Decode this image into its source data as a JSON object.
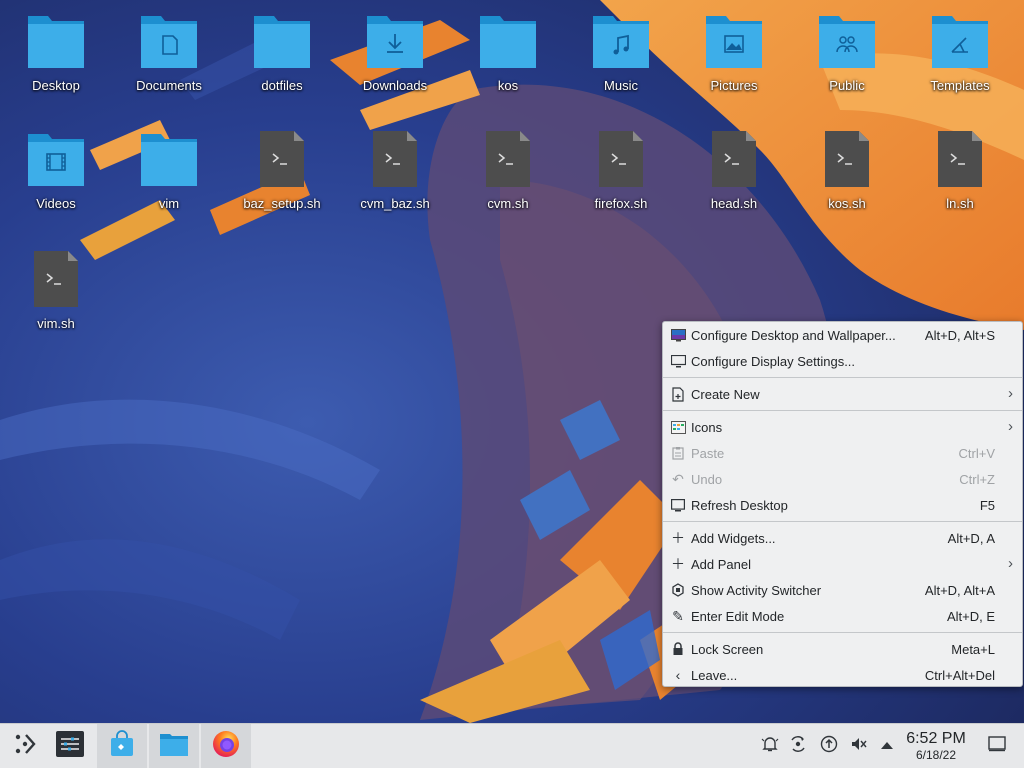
{
  "desktop": {
    "icons": [
      {
        "label": "Desktop",
        "kind": "folder",
        "glyph": "none"
      },
      {
        "label": "Documents",
        "kind": "folder",
        "glyph": "document"
      },
      {
        "label": "dotfiles",
        "kind": "folder",
        "glyph": "none"
      },
      {
        "label": "Downloads",
        "kind": "folder",
        "glyph": "download"
      },
      {
        "label": "kos",
        "kind": "folder",
        "glyph": "none"
      },
      {
        "label": "Music",
        "kind": "folder",
        "glyph": "music"
      },
      {
        "label": "Pictures",
        "kind": "folder",
        "glyph": "picture"
      },
      {
        "label": "Public",
        "kind": "folder",
        "glyph": "users"
      },
      {
        "label": "Templates",
        "kind": "folder",
        "glyph": "template"
      },
      {
        "label": "Videos",
        "kind": "folder",
        "glyph": "film"
      },
      {
        "label": "vim",
        "kind": "folder",
        "glyph": "none"
      },
      {
        "label": "baz_setup.sh",
        "kind": "script"
      },
      {
        "label": "cvm_baz.sh",
        "kind": "script"
      },
      {
        "label": "cvm.sh",
        "kind": "script"
      },
      {
        "label": "firefox.sh",
        "kind": "script"
      },
      {
        "label": "head.sh",
        "kind": "script"
      },
      {
        "label": "kos.sh",
        "kind": "script"
      },
      {
        "label": "ln.sh",
        "kind": "script"
      },
      {
        "label": "vim.sh",
        "kind": "script"
      }
    ]
  },
  "context_menu": {
    "items": [
      {
        "label": "Configure Desktop and Wallpaper...",
        "shortcut": "Alt+D, Alt+S",
        "icon": "wallpaper-icon"
      },
      {
        "label": "Configure Display Settings...",
        "shortcut": "",
        "icon": "display-icon"
      },
      {
        "label": "Create New",
        "shortcut": "",
        "icon": "new-file-icon"
      },
      {
        "label": "Icons",
        "shortcut": "",
        "icon": "icons-view-icon"
      },
      {
        "label": "Paste",
        "shortcut": "Ctrl+V",
        "icon": "paste-icon"
      },
      {
        "label": "Undo",
        "shortcut": "Ctrl+Z",
        "icon": "undo-icon"
      },
      {
        "label": "Refresh Desktop",
        "shortcut": "F5",
        "icon": "refresh-icon"
      },
      {
        "label": "Add Widgets...",
        "shortcut": "Alt+D, A",
        "icon": "plus-icon"
      },
      {
        "label": "Add Panel",
        "shortcut": "",
        "icon": "plus-icon"
      },
      {
        "label": "Show Activity Switcher",
        "shortcut": "Alt+D, Alt+A",
        "icon": "activities-icon"
      },
      {
        "label": "Enter Edit Mode",
        "shortcut": "Alt+D, E",
        "icon": "pencil-icon"
      },
      {
        "label": "Lock Screen",
        "shortcut": "Meta+L",
        "icon": "lock-icon"
      },
      {
        "label": "Leave...",
        "shortcut": "Ctrl+Alt+Del",
        "icon": "chevron-left-icon"
      }
    ]
  },
  "taskbar": {
    "launchers": [
      "application-launcher-icon",
      "settings-icon",
      "discover-store-icon",
      "file-manager-icon",
      "firefox-icon"
    ],
    "tray": [
      "notifications-icon",
      "kde-connect-icon",
      "updates-icon",
      "volume-muted-icon",
      "tray-expand-icon"
    ],
    "clock_time": "6:52 PM",
    "clock_date": "6/18/22"
  },
  "colors": {
    "folder": "#3daee9",
    "folder_dark": "#1d8fd0",
    "script": "#4d4d4d",
    "menu_bg": "#eff0f1",
    "panel_bg": "#e7e8ea"
  }
}
